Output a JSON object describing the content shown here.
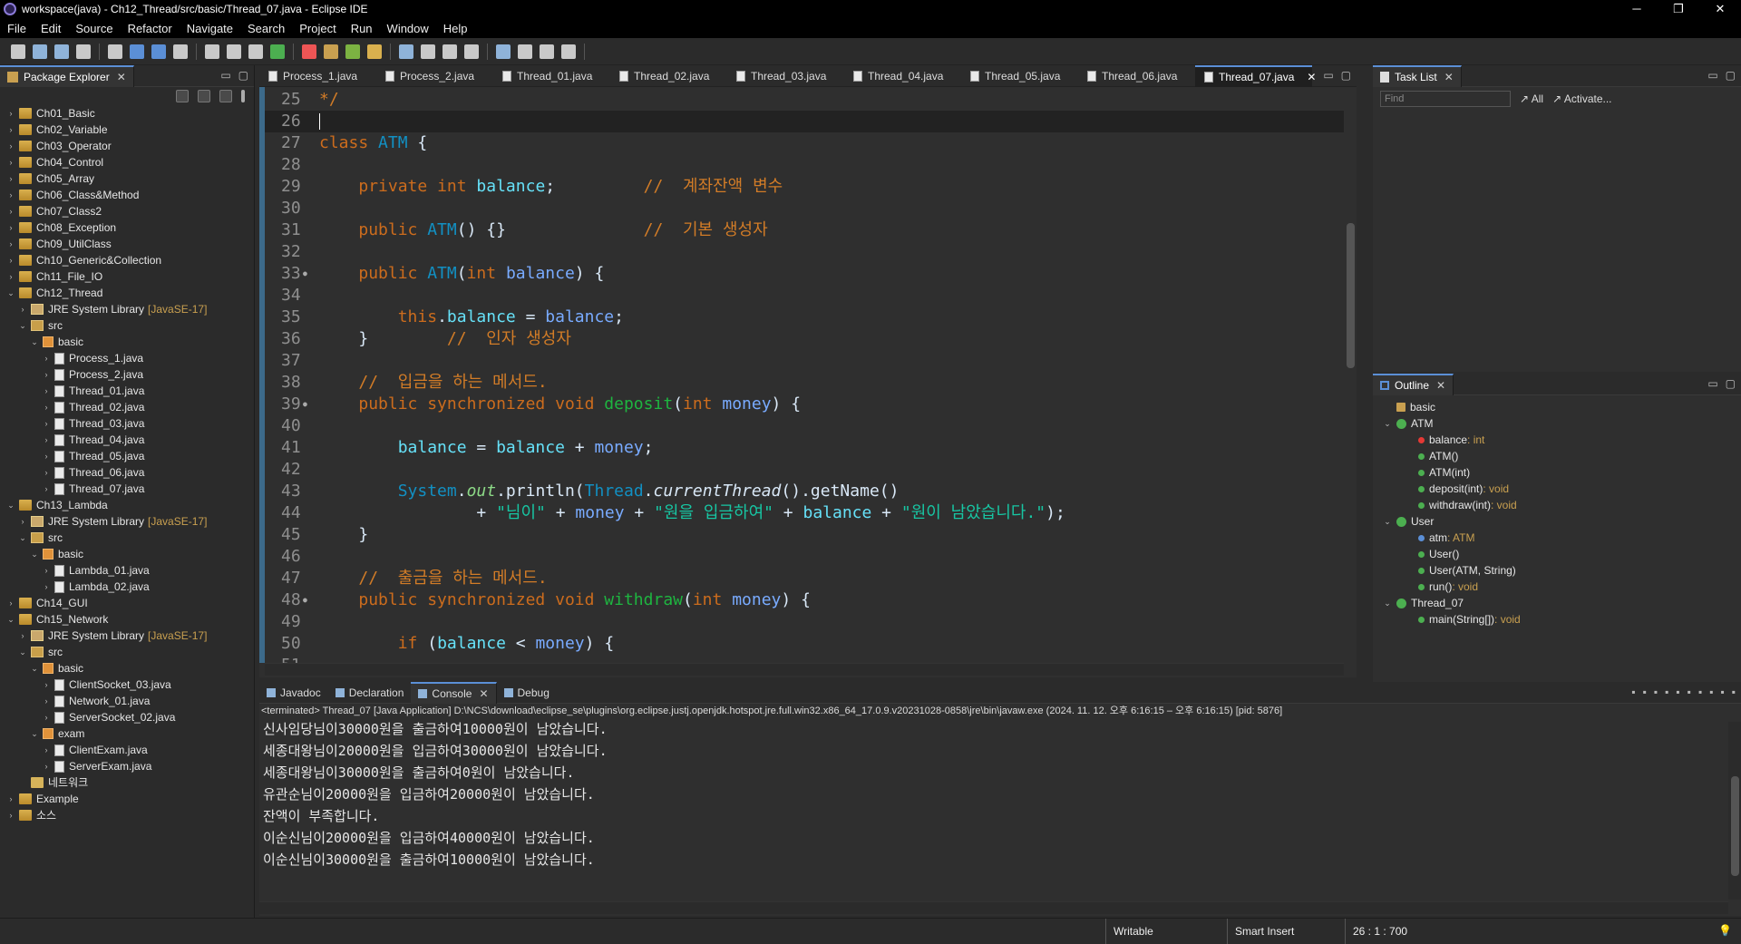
{
  "window": {
    "title": "workspace(java) - Ch12_Thread/src/basic/Thread_07.java - Eclipse IDE",
    "minimize": "─",
    "restore": "❐",
    "close": "✕"
  },
  "menu": [
    "File",
    "Edit",
    "Source",
    "Refactor",
    "Navigate",
    "Search",
    "Project",
    "Run",
    "Window",
    "Help"
  ],
  "package_explorer": {
    "title": "Package Explorer",
    "tree": [
      {
        "depth": 0,
        "tw": "›",
        "icon": "proj",
        "label": "Ch01_Basic"
      },
      {
        "depth": 0,
        "tw": "›",
        "icon": "proj",
        "label": "Ch02_Variable"
      },
      {
        "depth": 0,
        "tw": "›",
        "icon": "proj",
        "label": "Ch03_Operator"
      },
      {
        "depth": 0,
        "tw": "›",
        "icon": "proj",
        "label": "Ch04_Control"
      },
      {
        "depth": 0,
        "tw": "›",
        "icon": "proj",
        "label": "Ch05_Array"
      },
      {
        "depth": 0,
        "tw": "›",
        "icon": "proj",
        "label": "Ch06_Class&Method"
      },
      {
        "depth": 0,
        "tw": "›",
        "icon": "proj",
        "label": "Ch07_Class2"
      },
      {
        "depth": 0,
        "tw": "›",
        "icon": "proj",
        "label": "Ch08_Exception"
      },
      {
        "depth": 0,
        "tw": "›",
        "icon": "proj",
        "label": "Ch09_UtilClass"
      },
      {
        "depth": 0,
        "tw": "›",
        "icon": "proj",
        "label": "Ch10_Generic&Collection"
      },
      {
        "depth": 0,
        "tw": "›",
        "icon": "proj",
        "label": "Ch11_File_IO"
      },
      {
        "depth": 0,
        "tw": "⌄",
        "icon": "proj",
        "label": "Ch12_Thread"
      },
      {
        "depth": 1,
        "tw": "›",
        "icon": "lib",
        "label": "JRE System Library",
        "suffix": "[JavaSE-17]"
      },
      {
        "depth": 1,
        "tw": "⌄",
        "icon": "src",
        "label": "src"
      },
      {
        "depth": 2,
        "tw": "⌄",
        "icon": "pkg",
        "label": "basic"
      },
      {
        "depth": 3,
        "tw": "›",
        "icon": "java",
        "label": "Process_1.java"
      },
      {
        "depth": 3,
        "tw": "›",
        "icon": "java",
        "label": "Process_2.java"
      },
      {
        "depth": 3,
        "tw": "›",
        "icon": "java",
        "label": "Thread_01.java"
      },
      {
        "depth": 3,
        "tw": "›",
        "icon": "java",
        "label": "Thread_02.java"
      },
      {
        "depth": 3,
        "tw": "›",
        "icon": "java",
        "label": "Thread_03.java"
      },
      {
        "depth": 3,
        "tw": "›",
        "icon": "java",
        "label": "Thread_04.java"
      },
      {
        "depth": 3,
        "tw": "›",
        "icon": "java",
        "label": "Thread_05.java"
      },
      {
        "depth": 3,
        "tw": "›",
        "icon": "java",
        "label": "Thread_06.java"
      },
      {
        "depth": 3,
        "tw": "›",
        "icon": "java",
        "label": "Thread_07.java"
      },
      {
        "depth": 0,
        "tw": "⌄",
        "icon": "proj",
        "label": "Ch13_Lambda"
      },
      {
        "depth": 1,
        "tw": "›",
        "icon": "lib",
        "label": "JRE System Library",
        "suffix": "[JavaSE-17]"
      },
      {
        "depth": 1,
        "tw": "⌄",
        "icon": "src",
        "label": "src"
      },
      {
        "depth": 2,
        "tw": "⌄",
        "icon": "pkg",
        "label": "basic"
      },
      {
        "depth": 3,
        "tw": "›",
        "icon": "java",
        "label": "Lambda_01.java"
      },
      {
        "depth": 3,
        "tw": "›",
        "icon": "java",
        "label": "Lambda_02.java"
      },
      {
        "depth": 0,
        "tw": "›",
        "icon": "proj",
        "label": "Ch14_GUI"
      },
      {
        "depth": 0,
        "tw": "⌄",
        "icon": "proj",
        "label": "Ch15_Network"
      },
      {
        "depth": 1,
        "tw": "›",
        "icon": "lib",
        "label": "JRE System Library",
        "suffix": "[JavaSE-17]"
      },
      {
        "depth": 1,
        "tw": "⌄",
        "icon": "src",
        "label": "src"
      },
      {
        "depth": 2,
        "tw": "⌄",
        "icon": "pkg",
        "label": "basic"
      },
      {
        "depth": 3,
        "tw": "›",
        "icon": "java",
        "label": "ClientSocket_03.java"
      },
      {
        "depth": 3,
        "tw": "›",
        "icon": "java",
        "label": "Network_01.java"
      },
      {
        "depth": 3,
        "tw": "›",
        "icon": "java",
        "label": "ServerSocket_02.java"
      },
      {
        "depth": 2,
        "tw": "⌄",
        "icon": "pkg",
        "label": "exam"
      },
      {
        "depth": 3,
        "tw": "›",
        "icon": "java",
        "label": "ClientExam.java"
      },
      {
        "depth": 3,
        "tw": "›",
        "icon": "java",
        "label": "ServerExam.java"
      },
      {
        "depth": 1,
        "tw": "",
        "icon": "folder",
        "label": "네트워크"
      },
      {
        "depth": 0,
        "tw": "›",
        "icon": "proj",
        "label": "Example"
      },
      {
        "depth": 0,
        "tw": "›",
        "icon": "proj",
        "label": "소스"
      }
    ]
  },
  "editor": {
    "tabs": [
      "Process_1.java",
      "Process_2.java",
      "Thread_01.java",
      "Thread_02.java",
      "Thread_03.java",
      "Thread_04.java",
      "Thread_05.java",
      "Thread_06.java",
      "Thread_07.java"
    ],
    "active_tab": "Thread_07.java",
    "lines": [
      {
        "n": "25",
        "t": [
          [
            "cm",
            "*/"
          ]
        ]
      },
      {
        "n": "26",
        "t": [],
        "current": true
      },
      {
        "n": "27",
        "t": [
          [
            "kw",
            "class "
          ],
          [
            "cls",
            "ATM"
          ],
          [
            "pl",
            " {"
          ]
        ]
      },
      {
        "n": "28",
        "t": []
      },
      {
        "n": "29",
        "t": [
          [
            "pl",
            "    "
          ],
          [
            "kw",
            "private "
          ],
          [
            "ty",
            "int "
          ],
          [
            "fld",
            "balance"
          ],
          [
            "pl",
            ";         "
          ],
          [
            "cm",
            "//  계좌잔액 변수"
          ]
        ]
      },
      {
        "n": "30",
        "t": []
      },
      {
        "n": "31",
        "t": [
          [
            "pl",
            "    "
          ],
          [
            "kw",
            "public "
          ],
          [
            "cls",
            "ATM"
          ],
          [
            "pl",
            "() {}              "
          ],
          [
            "cm",
            "//  기본 생성자"
          ]
        ]
      },
      {
        "n": "32",
        "t": []
      },
      {
        "n": "33",
        "mark": true,
        "t": [
          [
            "pl",
            "    "
          ],
          [
            "kw",
            "public "
          ],
          [
            "cls",
            "ATM"
          ],
          [
            "pl",
            "("
          ],
          [
            "ty",
            "int "
          ],
          [
            "var",
            "balance"
          ],
          [
            "pl",
            ") {"
          ]
        ]
      },
      {
        "n": "34",
        "t": []
      },
      {
        "n": "35",
        "t": [
          [
            "pl",
            "        "
          ],
          [
            "kw",
            "this"
          ],
          [
            "pl",
            "."
          ],
          [
            "fld",
            "balance"
          ],
          [
            "pl",
            " = "
          ],
          [
            "var",
            "balance"
          ],
          [
            "pl",
            ";"
          ]
        ]
      },
      {
        "n": "36",
        "t": [
          [
            "pl",
            "    }        "
          ],
          [
            "cm",
            "//  인자 생성자"
          ]
        ]
      },
      {
        "n": "37",
        "t": []
      },
      {
        "n": "38",
        "t": [
          [
            "pl",
            "    "
          ],
          [
            "cm",
            "//  입금을 하는 메서드."
          ]
        ]
      },
      {
        "n": "39",
        "mark": true,
        "t": [
          [
            "pl",
            "    "
          ],
          [
            "kw",
            "public "
          ],
          [
            "kw",
            "synchronized "
          ],
          [
            "ty",
            "void "
          ],
          [
            "fn",
            "deposit"
          ],
          [
            "pl",
            "("
          ],
          [
            "ty",
            "int "
          ],
          [
            "var",
            "money"
          ],
          [
            "pl",
            ") {"
          ]
        ]
      },
      {
        "n": "40",
        "t": []
      },
      {
        "n": "41",
        "t": [
          [
            "pl",
            "        "
          ],
          [
            "fld",
            "balance"
          ],
          [
            "pl",
            " = "
          ],
          [
            "fld",
            "balance"
          ],
          [
            "pl",
            " + "
          ],
          [
            "var",
            "money"
          ],
          [
            "pl",
            ";"
          ]
        ]
      },
      {
        "n": "42",
        "t": []
      },
      {
        "n": "43",
        "t": [
          [
            "pl",
            "        "
          ],
          [
            "cls",
            "System"
          ],
          [
            "pl",
            "."
          ],
          [
            "stat",
            "out"
          ],
          [
            "pl",
            ".println("
          ],
          [
            "cls",
            "Thread"
          ],
          [
            "pl",
            "."
          ],
          [
            "it",
            "currentThread"
          ],
          [
            "pl",
            "().getName()"
          ]
        ]
      },
      {
        "n": "44",
        "t": [
          [
            "pl",
            "                + "
          ],
          [
            "st",
            "\"님이\""
          ],
          [
            "pl",
            " + "
          ],
          [
            "var",
            "money"
          ],
          [
            "pl",
            " + "
          ],
          [
            "st",
            "\"원을 입금하여\""
          ],
          [
            "pl",
            " + "
          ],
          [
            "fld",
            "balance"
          ],
          [
            "pl",
            " + "
          ],
          [
            "st",
            "\"원이 남았습니다.\""
          ],
          [
            "pl",
            ");"
          ]
        ]
      },
      {
        "n": "45",
        "t": [
          [
            "pl",
            "    }"
          ]
        ]
      },
      {
        "n": "46",
        "t": []
      },
      {
        "n": "47",
        "t": [
          [
            "pl",
            "    "
          ],
          [
            "cm",
            "//  출금을 하는 메서드."
          ]
        ]
      },
      {
        "n": "48",
        "mark": true,
        "t": [
          [
            "pl",
            "    "
          ],
          [
            "kw",
            "public "
          ],
          [
            "kw",
            "synchronized "
          ],
          [
            "ty",
            "void "
          ],
          [
            "fn",
            "withdraw"
          ],
          [
            "pl",
            "("
          ],
          [
            "ty",
            "int "
          ],
          [
            "var",
            "money"
          ],
          [
            "pl",
            ") {"
          ]
        ]
      },
      {
        "n": "49",
        "t": []
      },
      {
        "n": "50",
        "t": [
          [
            "pl",
            "        "
          ],
          [
            "kw",
            "if"
          ],
          [
            "pl",
            " ("
          ],
          [
            "fld",
            "balance"
          ],
          [
            "pl",
            " < "
          ],
          [
            "var",
            "money"
          ],
          [
            "pl",
            ") {"
          ]
        ]
      },
      {
        "n": "51",
        "t": []
      }
    ]
  },
  "task_list": {
    "title": "Task List",
    "find_placeholder": "Find",
    "all": "All",
    "activate": "Activate..."
  },
  "outline": {
    "title": "Outline",
    "items": [
      {
        "depth": 0,
        "tw": "",
        "icon": "pkg",
        "label": "basic"
      },
      {
        "depth": 0,
        "tw": "⌄",
        "icon": "cls",
        "label": "ATM"
      },
      {
        "depth": 1,
        "tw": "",
        "icon": "priv",
        "label": "balance",
        "type": " : int"
      },
      {
        "depth": 1,
        "tw": "",
        "icon": "pub",
        "label": "ATM()"
      },
      {
        "depth": 1,
        "tw": "",
        "icon": "pub",
        "label": "ATM(int)"
      },
      {
        "depth": 1,
        "tw": "",
        "icon": "pub",
        "label": "deposit(int)",
        "type": " : void"
      },
      {
        "depth": 1,
        "tw": "",
        "icon": "pub",
        "label": "withdraw(int)",
        "type": " : void"
      },
      {
        "depth": 0,
        "tw": "⌄",
        "icon": "cls",
        "label": "User"
      },
      {
        "depth": 1,
        "tw": "",
        "icon": "def",
        "label": "atm",
        "type": " : ATM"
      },
      {
        "depth": 1,
        "tw": "",
        "icon": "pub",
        "label": "User()"
      },
      {
        "depth": 1,
        "tw": "",
        "icon": "pub",
        "label": "User(ATM, String)"
      },
      {
        "depth": 1,
        "tw": "",
        "icon": "pub",
        "label": "run()",
        "type": " : void"
      },
      {
        "depth": 0,
        "tw": "⌄",
        "icon": "cls",
        "label": "Thread_07"
      },
      {
        "depth": 1,
        "tw": "",
        "icon": "pub",
        "label": "main(String[])",
        "type": " : void"
      }
    ]
  },
  "console": {
    "tabs": [
      "Javadoc",
      "Declaration",
      "Console",
      "Debug"
    ],
    "active_tab": "Console",
    "info": "<terminated> Thread_07 [Java Application] D:\\NCS\\download\\eclipse_se\\plugins\\org.eclipse.justj.openjdk.hotspot.jre.full.win32.x86_64_17.0.9.v20231028-0858\\jre\\bin\\javaw.exe  (2024. 11. 12. 오후 6:16:15 – 오후 6:16:15) [pid: 5876]",
    "lines": [
      "신사임당님이30000원을 출금하여10000원이 남았습니다.",
      "세종대왕님이20000원을 입금하여30000원이 남았습니다.",
      "세종대왕님이30000원을 출금하여0원이 남았습니다.",
      "유관순님이20000원을 입금하여20000원이 남았습니다.",
      "잔액이 부족합니다.",
      "이순신님이20000원을 입금하여40000원이 남았습니다.",
      "이순신님이30000원을 출금하여10000원이 남았습니다."
    ]
  },
  "status": {
    "writable": "Writable",
    "insert_mode": "Smart Insert",
    "position": "26 : 1 : 700"
  }
}
